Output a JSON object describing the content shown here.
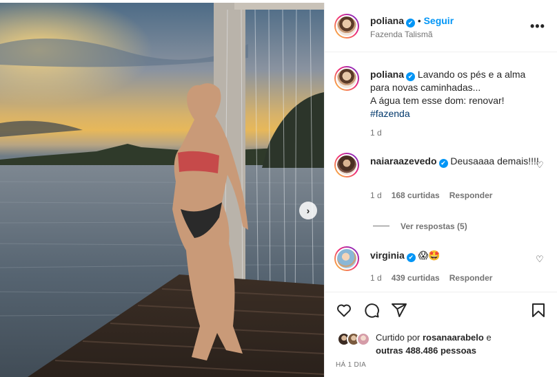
{
  "post": {
    "author": "poliana",
    "follow_label": "Seguir",
    "location": "Fazenda Talismã",
    "caption_line1": "Lavando os pés e a alma para novas caminhadas...",
    "caption_line2": "A água tem esse dom: renovar!",
    "hashtag": "#fazenda",
    "caption_time": "1 d"
  },
  "comments": [
    {
      "user": "naiaraazevedo",
      "text": "Deusaaaa demais!!!!",
      "time": "1 d",
      "likes": "168 curtidas",
      "reply_label": "Responder"
    },
    {
      "user": "virginia",
      "text": "😱🤩",
      "time": "1 d",
      "likes": "439 curtidas",
      "reply_label": "Responder"
    }
  ],
  "view_replies": "Ver respostas (5)",
  "likes": {
    "prefix": "Curtido por",
    "user": "rosanaarabelo",
    "conj": "e",
    "others": "outras 488.486 pessoas"
  },
  "posted_ago": "HÁ 1 DIA",
  "icons": {
    "verified": "✔",
    "more": "•••",
    "next": "›",
    "heart_small": "♡"
  },
  "colors": {
    "accent": "#0095f6",
    "hashtag": "#00376b",
    "muted": "#737373"
  }
}
